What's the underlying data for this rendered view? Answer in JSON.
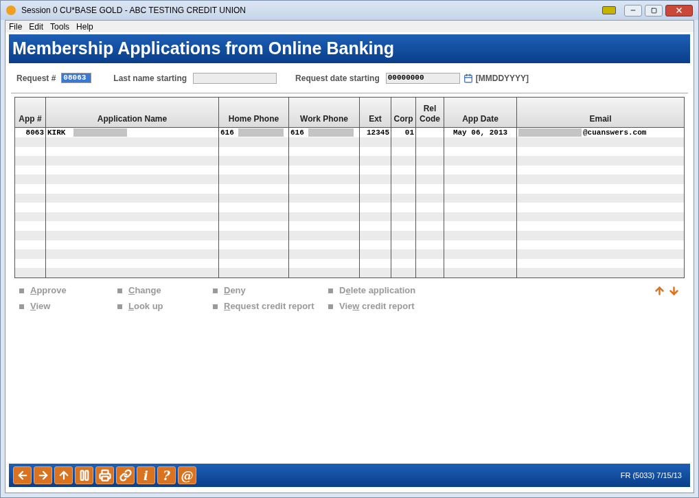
{
  "window": {
    "title": "Session 0 CU*BASE GOLD - ABC TESTING CREDIT UNION"
  },
  "menu": [
    "File",
    "Edit",
    "Tools",
    "Help"
  ],
  "header": {
    "title": "Membership Applications from Online Banking"
  },
  "filters": {
    "request_label": "Request #",
    "request_value": "08063",
    "last_name_label": "Last name starting",
    "request_date_label": "Request date starting",
    "request_date_value": "00000000",
    "date_format": "[MMDDYYYY]"
  },
  "table": {
    "columns": [
      "App #",
      "Application Name",
      "Home Phone",
      "Work Phone",
      "Ext",
      "Corp",
      "Rel Code",
      "App Date",
      "Email"
    ],
    "rows": [
      {
        "app": "8063",
        "name": "KIRK",
        "home_phone": "616",
        "work_phone": "616",
        "ext": "12345",
        "corp": "01",
        "app_date": "May 06, 2013",
        "email": "@cuanswers.com"
      }
    ]
  },
  "actions": [
    {
      "key": "A",
      "post": "pprove"
    },
    {
      "key": "C",
      "post": "hange"
    },
    {
      "key": "D",
      "post": "eny"
    },
    {
      "pre": "D",
      "key": "e",
      "post": "lete application"
    },
    {
      "key": "V",
      "post": "iew"
    },
    {
      "key": "L",
      "post": "ook up"
    },
    {
      "key": "R",
      "post": "equest credit report"
    },
    {
      "pre": "Vie",
      "key": "w",
      "post": " credit report"
    }
  ],
  "footer_buttons": [
    {
      "kind": "back"
    },
    {
      "kind": "forward"
    },
    {
      "kind": "up"
    },
    {
      "kind": "pause"
    },
    {
      "kind": "print"
    },
    {
      "kind": "link"
    },
    {
      "kind": "text",
      "label": "i"
    },
    {
      "kind": "text",
      "label": "?"
    },
    {
      "kind": "text",
      "label": "@"
    }
  ],
  "footer_status": "FR (5033) 7/15/13"
}
